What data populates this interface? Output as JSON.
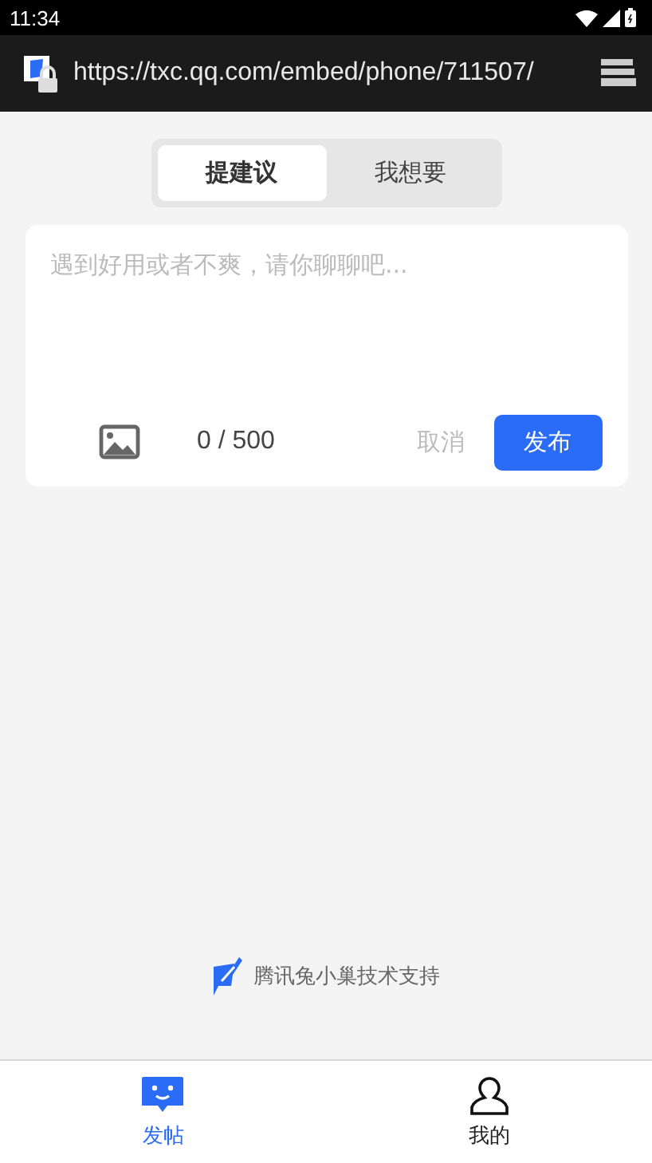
{
  "status_bar": {
    "time": "11:34"
  },
  "browser": {
    "url": "https://txc.qq.com/embed/phone/711507/"
  },
  "tabs": [
    {
      "label": "提建议",
      "selected": true
    },
    {
      "label": "我想要",
      "selected": false
    }
  ],
  "composer": {
    "placeholder": "遇到好用或者不爽，请你聊聊吧...",
    "counter": "0 / 500",
    "cancel": "取消",
    "submit": "发布"
  },
  "credit": "腾讯兔小巢技术支持",
  "nav": [
    {
      "label": "发帖",
      "kind": "post",
      "selected": true
    },
    {
      "label": "我的",
      "kind": "me",
      "selected": false
    }
  ]
}
